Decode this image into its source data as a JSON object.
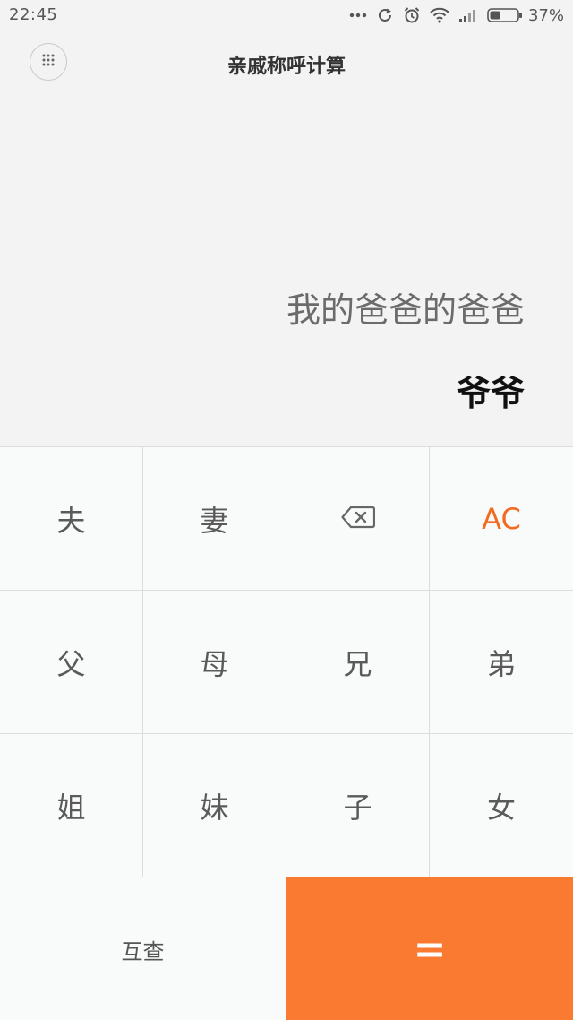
{
  "status_bar": {
    "time": "22:45",
    "icons": [
      "more-dots-icon",
      "sync-icon",
      "alarm-icon",
      "wifi-icon",
      "signal-icon",
      "battery-icon"
    ],
    "battery_percent": "37%"
  },
  "header": {
    "title": "亲戚称呼计算",
    "menu_icon": "grid-menu-icon"
  },
  "display": {
    "expression": "我的爸爸的爸爸",
    "result": "爷爷"
  },
  "keypad": {
    "rows": [
      [
        "夫",
        "妻",
        "",
        "AC"
      ],
      [
        "父",
        "母",
        "兄",
        "弟"
      ],
      [
        "姐",
        "妹",
        "子",
        "女"
      ]
    ],
    "backspace_icon": "backspace-icon",
    "mutual_label": "互查",
    "equals_label": "="
  },
  "colors": {
    "accent": "#fb7a31",
    "ac_text": "#f36b21",
    "background": "#f2f3f2",
    "keypad_bg": "#f9fafa"
  }
}
